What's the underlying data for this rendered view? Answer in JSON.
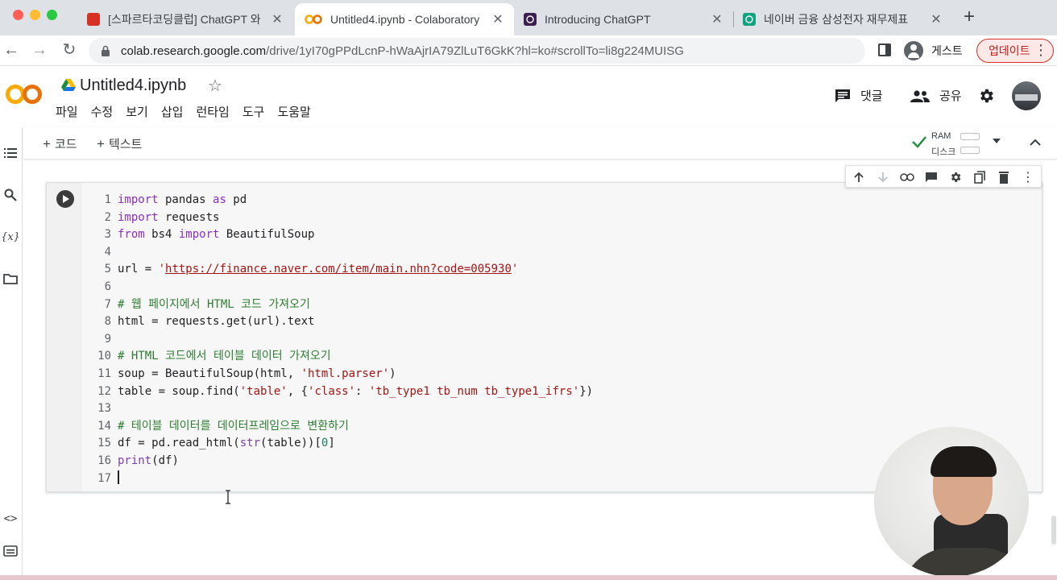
{
  "browser": {
    "tabs": [
      {
        "title": "[스파르타코딩클럽] ChatGPT 와 함",
        "favicon": "bookmark-icon",
        "favicon_color": "#d93025"
      },
      {
        "title": "Untitled4.ipynb - Colaboratory",
        "favicon": "colab-icon",
        "favicon_color": "#f9ab00"
      },
      {
        "title": "Introducing ChatGPT",
        "favicon": "openai-icon",
        "favicon_color": "#202124"
      },
      {
        "title": "네이버 금융 삼성전자 재무제표",
        "favicon": "openai-icon",
        "favicon_color": "#10a37f"
      }
    ],
    "active_tab": 1,
    "url_host": "colab.research.google.com",
    "url_rest": "/drive/1yI70gPPdLcnP-hWaAjrIA79ZlLuT6GkK?hl=ko#scrollTo=li8g224MUISG",
    "guest_label": "게스트",
    "update_label": "업데이트"
  },
  "colab": {
    "notebook_title": "Untitled4.ipynb",
    "menu": [
      "파일",
      "수정",
      "보기",
      "삽입",
      "런타임",
      "도구",
      "도움말"
    ],
    "comment_label": "댓글",
    "share_label": "공유",
    "toolbar": {
      "add_code_label": "코드",
      "add_text_label": "텍스트",
      "ram_label": "RAM",
      "disk_label": "디스크"
    },
    "accent_color": "#f9ab00"
  },
  "cell": {
    "lines": [
      {
        "n": "1",
        "text": "import pandas as pd"
      },
      {
        "n": "2",
        "text": "import requests"
      },
      {
        "n": "3",
        "text": "from bs4 import BeautifulSoup"
      },
      {
        "n": "4",
        "text": ""
      },
      {
        "n": "5",
        "text": "url = 'https://finance.naver.com/item/main.nhn?code=005930'"
      },
      {
        "n": "6",
        "text": ""
      },
      {
        "n": "7",
        "text": "# 웹 페이지에서 HTML 코드 가져오기"
      },
      {
        "n": "8",
        "text": "html = requests.get(url).text"
      },
      {
        "n": "9",
        "text": ""
      },
      {
        "n": "10",
        "text": "# HTML 코드에서 테이블 데이터 가져오기"
      },
      {
        "n": "11",
        "text": "soup = BeautifulSoup(html, 'html.parser')"
      },
      {
        "n": "12",
        "text": "table = soup.find('table', {'class': 'tb_type1 tb_num tb_type1_ifrs'})"
      },
      {
        "n": "13",
        "text": ""
      },
      {
        "n": "14",
        "text": "# 테이블 데이터를 데이터프레임으로 변환하기"
      },
      {
        "n": "15",
        "text": "df = pd.read_html(str(table))[0]"
      },
      {
        "n": "16",
        "text": "print(df)"
      },
      {
        "n": "17",
        "text": ""
      }
    ]
  }
}
